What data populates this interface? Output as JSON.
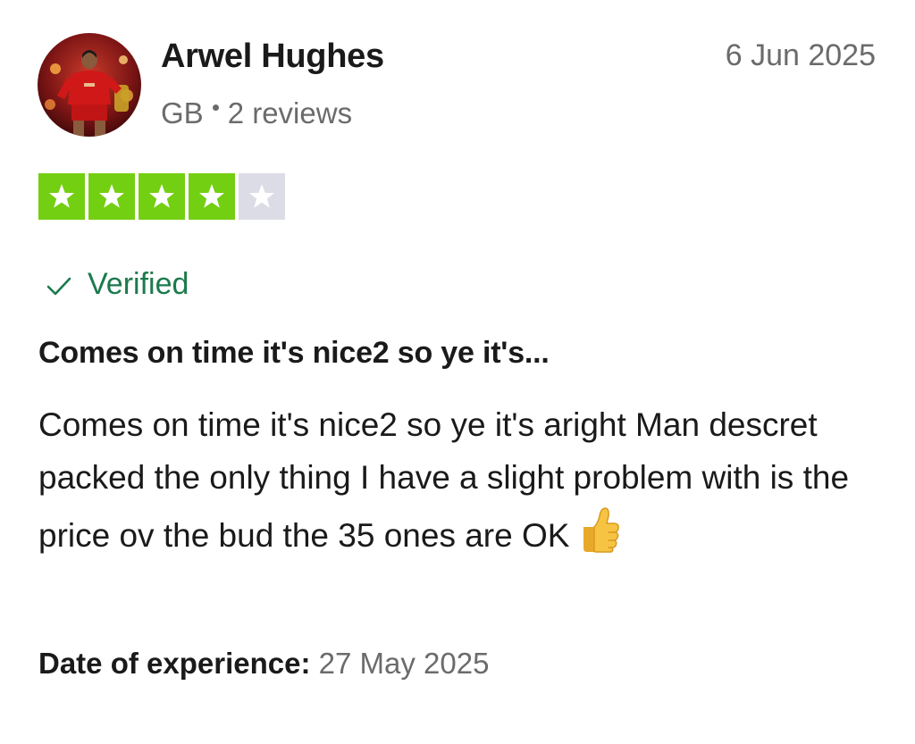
{
  "reviewer": {
    "name": "Arwel Hughes",
    "country": "GB",
    "reviews_count": "2 reviews",
    "avatar_icon": "user-avatar-photo"
  },
  "review": {
    "date": "6 Jun 2025",
    "rating": 4,
    "max_rating": 5,
    "verified_label": "Verified",
    "title": "Comes on time it's nice2 so ye it's...",
    "body": "Comes on time it's nice2 so ye it's aright Man descret packed the only thing I have a slight problem with is the price ov the bud the 35 ones are OK",
    "body_emoji": "thumbs-up-icon",
    "experience_label": "Date of experience:",
    "experience_date": "27 May 2025"
  },
  "colors": {
    "star_filled": "#73cf11",
    "star_empty": "#dcdce6",
    "verified": "#1b7a4c",
    "muted_text": "#6b6b6b",
    "text": "#1a1a1a"
  }
}
